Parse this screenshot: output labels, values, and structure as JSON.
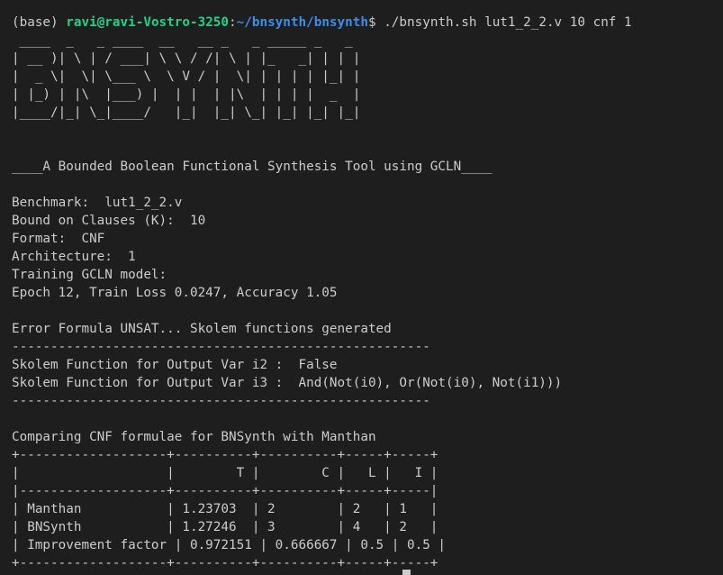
{
  "prompt": {
    "env": "(base) ",
    "user_host": "ravi@ravi-Vostro-3250",
    "colon": ":",
    "cwd": "~/bnsynth/bnsynth",
    "dollar": "$ ",
    "command": "./bnsynth.sh lut1_2_2.v 10 cnf 1"
  },
  "banner": [
    " ____  _   _ ____  __   __ _   _ _____ _   _ ",
    "| __ )| \\ | / ___| \\ \\ / /| \\ | |_   _| | | |",
    "|  _ \\|  \\| \\___ \\  \\ V / |  \\| | | | | |_| |",
    "| |_) | |\\  |___) |  | |  | |\\  | | | |  _  |",
    "|____/|_| \\_|____/   |_|  |_| \\_| |_| |_| |_|"
  ],
  "tagline": "____A Bounded Boolean Functional Synthesis Tool using GCLN____",
  "info": [
    "Benchmark:  lut1_2_2.v",
    "Bound on Clauses (K):  10",
    "Format:  CNF",
    "Architecture:  1",
    "Training GCLN model:",
    "Epoch 12, Train Loss 0.0247, Accuracy 1.05"
  ],
  "result_lines": [
    "Error Formula UNSAT... Skolem functions generated",
    "------------------------------------------------------",
    "Skolem Function for Output Var i2 :  False",
    "Skolem Function for Output Var i3 :  And(Not(i0), Or(Not(i0), Not(i1)))",
    "------------------------------------------------------"
  ],
  "compare_title": "Comparing CNF formulae for BNSynth with Manthan",
  "table_lines": [
    "+-------------------+----------+----------+-----+-----+",
    "|                   |        T |        C |   L |   I |",
    "|-------------------+----------+----------+-----+-----|",
    "| Manthan           | 1.23703  | 2        | 2   | 1   |",
    "| BNSynth           | 1.27246  | 3        | 4   | 2   |",
    "| Improvement factor | 0.972151 | 0.666667 | 0.5 | 0.5 |",
    "+-------------------+----------+----------+-----+-----+"
  ],
  "colors": {
    "background": "#1e1e1e",
    "foreground": "#cccccc",
    "user_host": "#23d18b",
    "cwd": "#3b8eea"
  }
}
